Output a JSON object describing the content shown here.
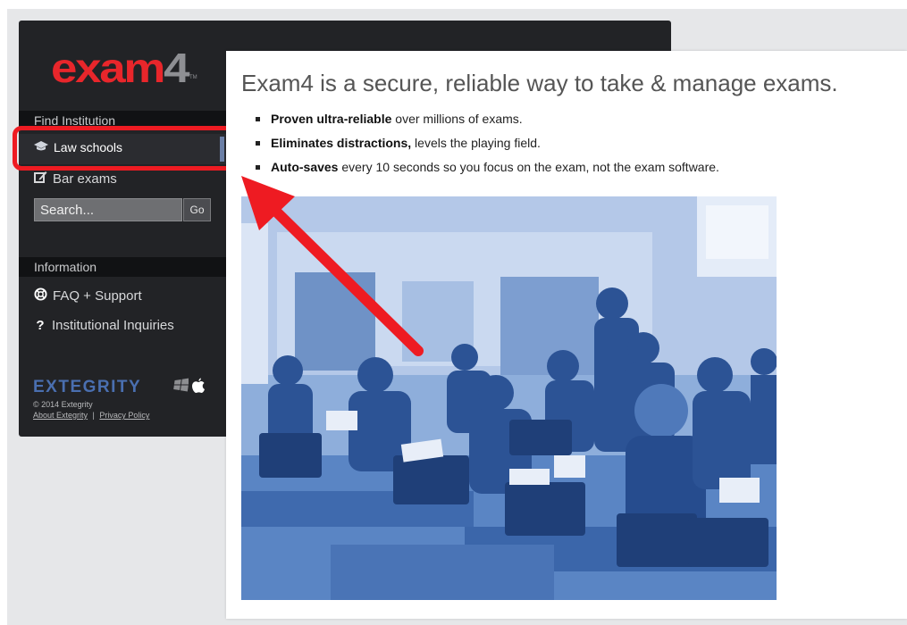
{
  "logo": {
    "main": "exam",
    "digit": "4",
    "tm": "TM"
  },
  "sidebar": {
    "find_heading": "Find Institution",
    "items": [
      {
        "label": "Law schools",
        "icon": "graduation-cap-icon",
        "active": true
      },
      {
        "label": "Bar exams",
        "icon": "edit-icon",
        "active": false
      }
    ],
    "search": {
      "placeholder": "Search...",
      "go_label": "Go"
    },
    "info_heading": "Information",
    "info_items": [
      {
        "label": "FAQ + Support",
        "icon": "lifebuoy-icon"
      },
      {
        "label": "Institutional Inquiries",
        "icon": "question-icon"
      }
    ],
    "footer": {
      "brand": "EXTEGRITY",
      "platform_icons": [
        "windows-icon",
        "apple-icon"
      ],
      "copyright": "© 2014 Extegrity",
      "about_link": "About Extegrity",
      "separator": "|",
      "privacy_link": "Privacy Policy"
    }
  },
  "main": {
    "headline": "Exam4 is a secure, reliable way to take & manage exams.",
    "bullets": [
      {
        "bold": "Proven ultra-reliable",
        "rest": " over millions of exams."
      },
      {
        "bold": "Eliminates distractions,",
        "rest": " levels the playing field."
      },
      {
        "bold": "Auto-saves",
        "rest": " every 10 seconds so you focus on the exam, not the exam software."
      }
    ]
  },
  "colors": {
    "sidebar_bg": "#222326",
    "logo_red": "#e8262b",
    "brand_blue": "#4a6fb0",
    "highlight_red": "#ee1b22",
    "photo_tint": "#5d8ad0"
  }
}
